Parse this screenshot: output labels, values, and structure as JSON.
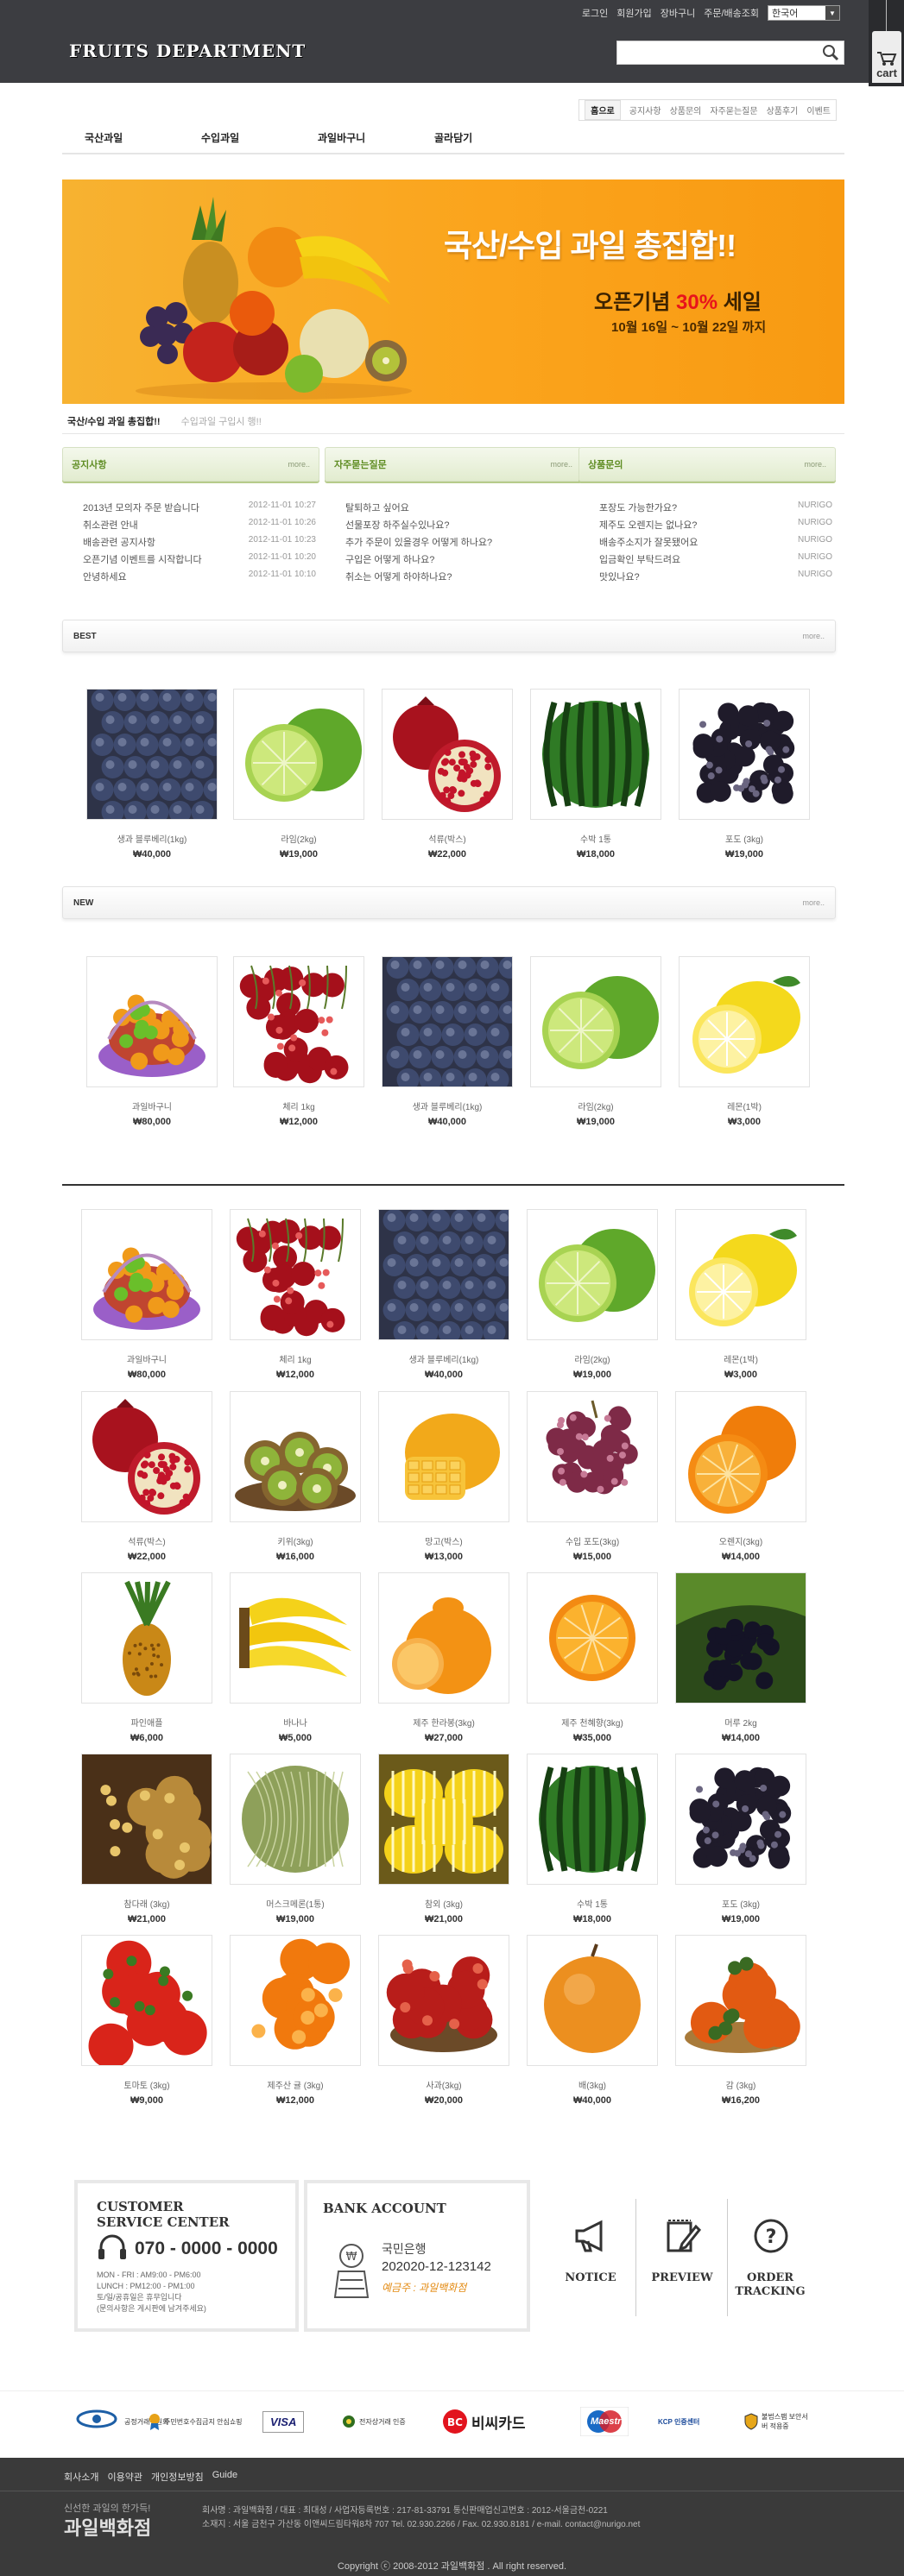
{
  "header": {
    "top_links": [
      "로그인",
      "회원가입",
      "장바구니",
      "주문/배송조회"
    ],
    "language": "한국어",
    "logo": "FRUITS DEPARTMENT",
    "search_placeholder": "",
    "cart_label": "cart"
  },
  "subnav": [
    "홈으로",
    "공지사항",
    "상품문의",
    "자주묻는질문",
    "상품후기",
    "이벤트"
  ],
  "mainnav": [
    "국산과일",
    "수입과일",
    "과일바구니",
    "골라담기"
  ],
  "banner": {
    "title": "국산/수입 과일 총집합!!",
    "sale_prefix": "오픈기념 ",
    "sale_pct": "30%",
    "sale_suffix": " 세일",
    "dates": "10월 16일 ~ 10월 22일 까지",
    "tab_active": "국산/수입 과일 총집합!!",
    "tab_inactive": "수입과일 구입시 행!!"
  },
  "boards": [
    {
      "title": "공지사항",
      "more": "more..",
      "items": [
        {
          "text": "2013년 모의자 주문 받습니다",
          "date": "2012-11-01 10:27"
        },
        {
          "text": "취소관련 안내",
          "date": "2012-11-01 10:26"
        },
        {
          "text": "배송관련 공지사항",
          "date": "2012-11-01 10:23"
        },
        {
          "text": "오픈기념 이벤트를 시작합니다",
          "date": "2012-11-01 10:20"
        },
        {
          "text": "안녕하세요",
          "date": "2012-11-01 10:10"
        }
      ]
    },
    {
      "title": "자주묻는질문",
      "more": "more..",
      "items": [
        {
          "text": "탈퇴하고 싶어요",
          "date": ""
        },
        {
          "text": "선물포장 하주실수있나요?",
          "date": ""
        },
        {
          "text": "추가 주문이 있을경우 어떻게 하나요?",
          "date": ""
        },
        {
          "text": "구입은 어떻게 하나요?",
          "date": ""
        },
        {
          "text": "취소는 어떻게 하야하나요?",
          "date": ""
        }
      ]
    },
    {
      "title": "상품문의",
      "more": "more..",
      "items": [
        {
          "text": "포장도 가능한가요?",
          "date": "NURIGO"
        },
        {
          "text": "제주도 오렌지는 없나요?",
          "date": "NURIGO"
        },
        {
          "text": "배송주소지가 잘못됐어요",
          "date": "NURIGO"
        },
        {
          "text": "입금확인 부탁드려요",
          "date": "NURIGO"
        },
        {
          "text": "맛있나요?",
          "date": "NURIGO"
        }
      ]
    }
  ],
  "sections": {
    "best": {
      "title": "BEST",
      "more": "more.."
    },
    "new": {
      "title": "NEW",
      "more": "more.."
    }
  },
  "best_products": [
    {
      "name": "생과 블루베리(1kg)",
      "price": "₩40,000",
      "icon": "blueberry"
    },
    {
      "name": "라임(2kg)",
      "price": "₩19,000",
      "icon": "lime"
    },
    {
      "name": "석류(박스)",
      "price": "₩22,000",
      "icon": "pomegranate"
    },
    {
      "name": "수박 1통",
      "price": "₩18,000",
      "icon": "watermelon"
    },
    {
      "name": "포도 (3kg)",
      "price": "₩19,000",
      "icon": "grape"
    }
  ],
  "new_products": [
    {
      "name": "과일바구니",
      "price": "₩80,000",
      "icon": "basket"
    },
    {
      "name": "체리 1kg",
      "price": "₩12,000",
      "icon": "cherry"
    },
    {
      "name": "생과 블루베리(1kg)",
      "price": "₩40,000",
      "icon": "blueberry"
    },
    {
      "name": "라임(2kg)",
      "price": "₩19,000",
      "icon": "lime"
    },
    {
      "name": "레몬(1박)",
      "price": "₩3,000",
      "icon": "lemon"
    }
  ],
  "all_products": [
    {
      "name": "과일바구니",
      "price": "₩80,000",
      "icon": "basket"
    },
    {
      "name": "체리 1kg",
      "price": "₩12,000",
      "icon": "cherry"
    },
    {
      "name": "생과 블루베리(1kg)",
      "price": "₩40,000",
      "icon": "blueberry"
    },
    {
      "name": "라임(2kg)",
      "price": "₩19,000",
      "icon": "lime"
    },
    {
      "name": "레몬(1박)",
      "price": "₩3,000",
      "icon": "lemon"
    },
    {
      "name": "석류(박스)",
      "price": "₩22,000",
      "icon": "pomegranate"
    },
    {
      "name": "키위(3kg)",
      "price": "₩16,000",
      "icon": "kiwi"
    },
    {
      "name": "망고(박스)",
      "price": "₩13,000",
      "icon": "mango"
    },
    {
      "name": "수입 포도(3kg)",
      "price": "₩15,000",
      "icon": "redgrape"
    },
    {
      "name": "오렌지(3kg)",
      "price": "₩14,000",
      "icon": "orange"
    },
    {
      "name": "파인애플",
      "price": "₩6,000",
      "icon": "pineapple"
    },
    {
      "name": "바나나",
      "price": "₩5,000",
      "icon": "banana"
    },
    {
      "name": "제주 한라봉(3kg)",
      "price": "₩27,000",
      "icon": "hallabong"
    },
    {
      "name": "제주 천혜향(3kg)",
      "price": "₩35,000",
      "icon": "tangerine"
    },
    {
      "name": "머루 2kg",
      "price": "₩14,000",
      "icon": "wildgrape"
    },
    {
      "name": "참다래 (3kg)",
      "price": "₩21,000",
      "icon": "goldkiwi"
    },
    {
      "name": "머스크메론(1통)",
      "price": "₩19,000",
      "icon": "melon"
    },
    {
      "name": "참외 (3kg)",
      "price": "₩21,000",
      "icon": "koreanmelon"
    },
    {
      "name": "수박 1통",
      "price": "₩18,000",
      "icon": "watermelon"
    },
    {
      "name": "포도 (3kg)",
      "price": "₩19,000",
      "icon": "grape"
    },
    {
      "name": "토마토 (3kg)",
      "price": "₩9,000",
      "icon": "tomato"
    },
    {
      "name": "제주산 귤 (3kg)",
      "price": "₩12,000",
      "icon": "mandarin"
    },
    {
      "name": "사과(3kg)",
      "price": "₩20,000",
      "icon": "apple"
    },
    {
      "name": "배(3kg)",
      "price": "₩40,000",
      "icon": "pear"
    },
    {
      "name": "감 (3kg)",
      "price": "₩16,200",
      "icon": "persimmon"
    }
  ],
  "customer": {
    "title1": "CUSTOMER",
    "title2": "SERVICE CENTER",
    "phone": "070 - 0000 - 0000",
    "hours1": "MON - FRI : AM9:00 - PM6:00",
    "hours2": "LUNCH : PM12:00 - PM1:00",
    "hours3": "토/일/공휴일은 휴무입니다",
    "hours4": "(문의사항은 게시판에 남겨주세요)"
  },
  "bank": {
    "title": "BANK ACCOUNT",
    "name": "국민은행",
    "account": "202020-12-123142",
    "holder": "예금주 : 과일백화점"
  },
  "quick_links": [
    "NOTICE",
    "PREVIEW",
    "ORDER TRACKING"
  ],
  "payment_logos": [
    "공정거래위원회",
    "주민번호수집금지 안심쇼핑",
    "VISA",
    "전자상거래 인증",
    "비씨카드",
    "Maestro",
    "KCP 인증센터",
    "불법스팸 보안서버 적용중"
  ],
  "footer": {
    "links": [
      "회사소개",
      "이용약관",
      "개인정보방침",
      "Guide"
    ],
    "slogan": "신선한 과일의 한가득!",
    "brand": "과일백화점",
    "addr1": "회사명 : 과일백화점 / 대표 : 최대성 / 사업자등록번호 : 217-81-33791 통신판매업신고번호 : 2012-서울금천-0221",
    "addr2": "소재지 : 서울 금천구 가산동 이앤씨드림타워8차 707 Tel. 02.930.2266 / Fax. 02.930.8181 / e-mail. contact@nurigo.net",
    "copyright": "Copyright ⓒ 2008-2012 과일백화점 . All right reserved."
  },
  "colors": {
    "header_bg": "#3c3d41",
    "banner_orange": "#f9a81f",
    "board_green": "#5f8d23",
    "sale_red": "#e8141b",
    "footer_bg": "#3a3a3a"
  }
}
